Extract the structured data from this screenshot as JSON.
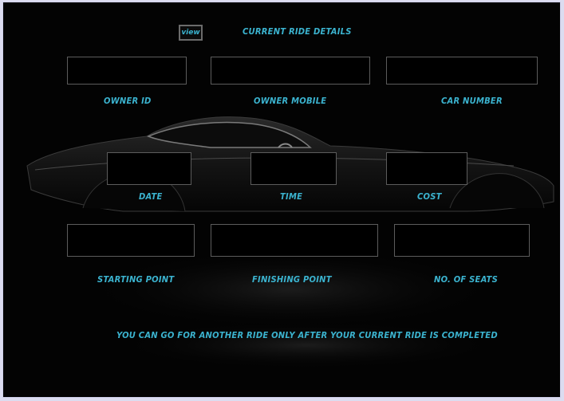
{
  "header": {
    "view_button": "view",
    "title": "CURRENT RIDE DETAILS"
  },
  "fields": {
    "owner_id": {
      "label": "OWNER ID",
      "value": ""
    },
    "owner_mobile": {
      "label": "OWNER MOBILE",
      "value": ""
    },
    "car_number": {
      "label": "CAR NUMBER",
      "value": ""
    },
    "date": {
      "label": "DATE",
      "value": ""
    },
    "time": {
      "label": "TIME",
      "value": ""
    },
    "cost": {
      "label": "COST",
      "value": ""
    },
    "starting_point": {
      "label": "STARTING POINT",
      "value": ""
    },
    "finishing_point": {
      "label": "FINISHING POINT",
      "value": ""
    },
    "no_of_seats": {
      "label": "NO. OF SEATS",
      "value": ""
    }
  },
  "notice": "YOU CAN GO FOR ANOTHER RIDE ONLY AFTER YOUR CURRENT RIDE IS COMPLETED",
  "colors": {
    "accent": "#3bb3cf",
    "background": "#030303",
    "field_border": "#5c5c5c"
  }
}
